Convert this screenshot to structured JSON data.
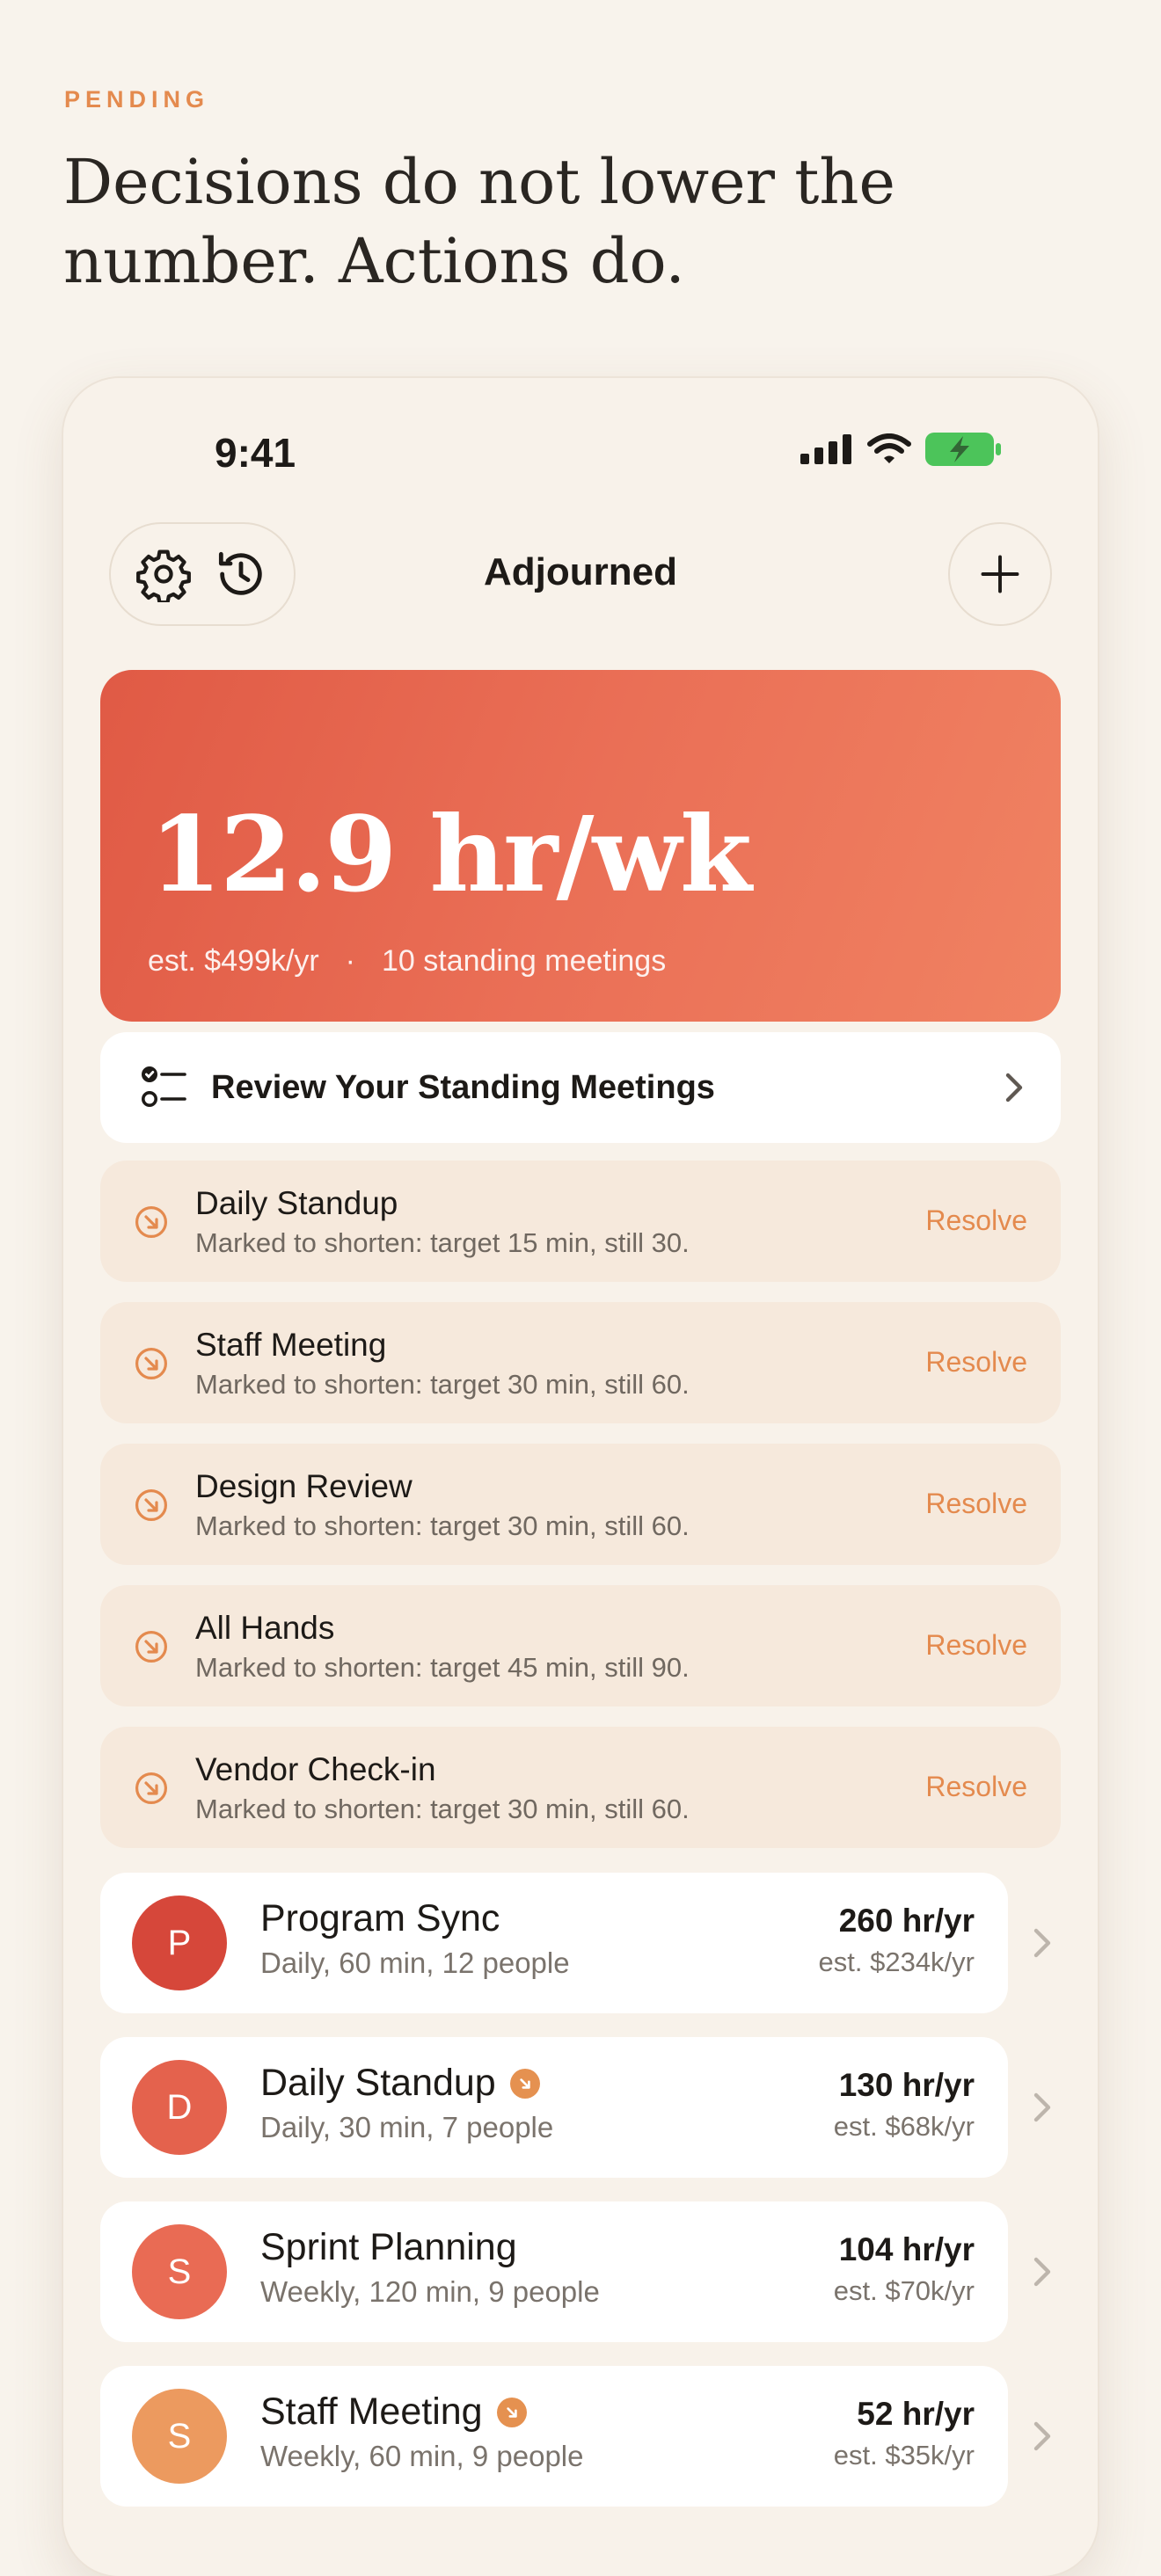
{
  "intro": {
    "eyebrow": "PENDING",
    "headline": "Decisions do not lower the number. Actions do."
  },
  "status_bar": {
    "time": "9:41"
  },
  "nav": {
    "title": "Adjourned"
  },
  "hero": {
    "value": "12.9 hr/wk",
    "cost": "est. $499k/yr",
    "separator": "·",
    "meetings": "10 standing meetings"
  },
  "review": {
    "label": "Review Your Standing Meetings"
  },
  "pending": [
    {
      "title": "Daily Standup",
      "subtitle": "Marked to shorten: target 15 min, still 30.",
      "action": "Resolve"
    },
    {
      "title": "Staff Meeting",
      "subtitle": "Marked to shorten: target 30 min, still 60.",
      "action": "Resolve"
    },
    {
      "title": "Design Review",
      "subtitle": "Marked to shorten: target 30 min, still 60.",
      "action": "Resolve"
    },
    {
      "title": "All Hands",
      "subtitle": "Marked to shorten: target 45 min, still 90.",
      "action": "Resolve"
    },
    {
      "title": "Vendor Check-in",
      "subtitle": "Marked to shorten: target 30 min, still 60.",
      "action": "Resolve"
    }
  ],
  "meetings": [
    {
      "initial": "P",
      "title": "Program Sync",
      "subtitle": "Daily, 60 min, 12 people",
      "rate": "260 hr/yr",
      "cost": "est. $234k/yr",
      "color": "#d6473a",
      "pending": false
    },
    {
      "initial": "D",
      "title": "Daily Standup",
      "subtitle": "Daily, 30 min, 7 people",
      "rate": "130 hr/yr",
      "cost": "est. $68k/yr",
      "color": "#e4624d",
      "pending": true
    },
    {
      "initial": "S",
      "title": "Sprint Planning",
      "subtitle": "Weekly, 120 min, 9 people",
      "rate": "104 hr/yr",
      "cost": "est. $70k/yr",
      "color": "#e96b54",
      "pending": false
    },
    {
      "initial": "S",
      "title": "Staff Meeting",
      "subtitle": "Weekly, 60 min, 9 people",
      "rate": "52 hr/yr",
      "cost": "est. $35k/yr",
      "color": "#ec9a5f",
      "pending": true
    }
  ],
  "colors": {
    "accent": "#e48a4e",
    "hero_start": "#e05a45",
    "hero_end": "#f08262",
    "background": "#f8f3ec",
    "pending_bg": "#f6e9dc"
  },
  "icons": [
    "gear-icon",
    "history-icon",
    "plus-icon",
    "checklist-icon",
    "chevron-right-icon",
    "shorten-icon",
    "signal-icon",
    "wifi-icon",
    "battery-icon"
  ]
}
